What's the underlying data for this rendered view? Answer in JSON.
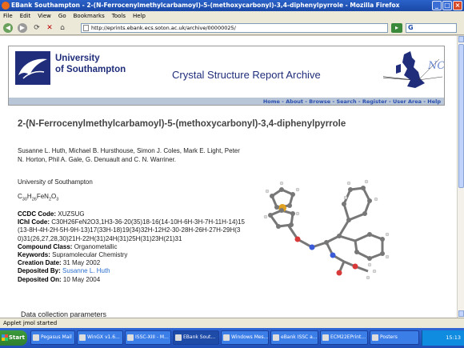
{
  "window": {
    "title": "EBank Southampton - 2-(N-Ferrocenylmethylcarbamoyl)-5-(methoxycarbonyl)-3,4-diphenylpyrrole - Mozilla Firefox",
    "min": "_",
    "max": "□",
    "close": "×"
  },
  "menu": [
    "File",
    "Edit",
    "View",
    "Go",
    "Bookmarks",
    "Tools",
    "Help"
  ],
  "nav": {
    "url": "http://eprints.ebank.ecs.soton.ac.uk/archive/00000025/",
    "search_placeholder": "G"
  },
  "banner": {
    "uni_line1": "University",
    "uni_line2": "of Southampton",
    "archive_title": "Crystal Structure Report Archive"
  },
  "links": [
    "Home",
    "About",
    "Browse",
    "Search",
    "Register",
    "User Area",
    "Help"
  ],
  "record": {
    "title": "2-(N-Ferrocenylmethylcarbamoyl)-5-(methoxycarbonyl)-3,4-diphenylpyrrole",
    "authors": "Susanne L. Huth, Michael B. Hursthouse, Simon J. Coles, Mark E. Light, Peter N. Horton, Phil A. Gale, G. Denuault and C. N. Warriner.",
    "institution": "University of Southampton",
    "formula_parts": [
      "C",
      "30",
      "H",
      "26",
      "FeN",
      "2",
      "O",
      "3"
    ],
    "ccdc_label": "CCDC Code:",
    "ccdc_value": "XUZSUG",
    "inchi_label": "IChI Code:",
    "inchi_value": "C30H26FeN2O3,1H3-36-20(35)18-16(14-10H-6H-3H-7H-11H-14)15(13-8H-4H-2H-5H-9H-13)17(33H-18)19(34)32H-12H2-30-28H-26H-27H-29H(30)31(26,27,28,30)21H-22H(31)24H(31)25H(31)23H(21)31",
    "class_label": "Compound Class:",
    "class_value": "Organometallic",
    "keywords_label": "Keywords:",
    "keywords_value": "Supramolecular Chemistry",
    "created_label": "Creation Date:",
    "created_value": "31 May 2002",
    "deposited_by_label": "Deposited By:",
    "deposited_by_value": "Susanne L. Huth",
    "deposited_on_label": "Deposited On:",
    "deposited_on_value": "10 May 2004",
    "dc_heading": "Data collection parameters"
  },
  "status": "Applet jmol started",
  "taskbar": {
    "start": "Start",
    "tasks": [
      "Pegasus Mail",
      "WinGX v1.6...",
      "ISSC-XIII - M...",
      "EBank Sout...",
      "Windows Mes...",
      "eBank ISSC a...",
      "ECM22EPrint...",
      "Posters"
    ],
    "clock": "15:13"
  }
}
